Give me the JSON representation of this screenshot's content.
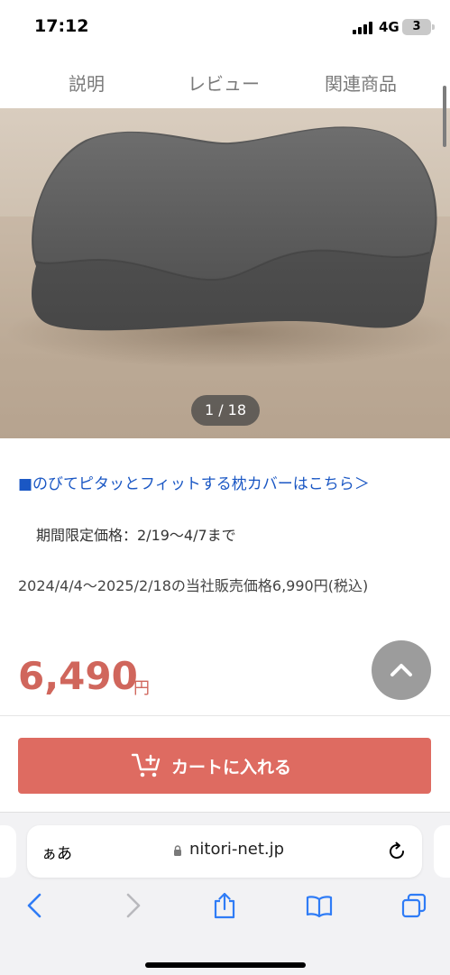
{
  "status_bar": {
    "time": "17:12",
    "network": "4G",
    "battery": "3"
  },
  "tabs": [
    {
      "label": "説明"
    },
    {
      "label": "レビュー"
    },
    {
      "label": "関連商品"
    }
  ],
  "gallery": {
    "counter": "1 / 18"
  },
  "product": {
    "cover_link": "■のびてピタッとフィットする枕カバーはこちら＞",
    "period_text": "期間限定価格：2/19〜4/7まで",
    "price_note": "2024/4/4〜2025/2/18の当社販売価格6,990円(税込)",
    "price": "6,490",
    "currency": "円"
  },
  "cart_button": {
    "label": "カートに入れる"
  },
  "browser": {
    "aa_label": "ぁあ",
    "url": "nitori-net.jp"
  },
  "colors": {
    "accent": "#de6b61",
    "price": "#d0665c",
    "link": "#1a57c4",
    "ios_blue": "#2f7cf6"
  }
}
